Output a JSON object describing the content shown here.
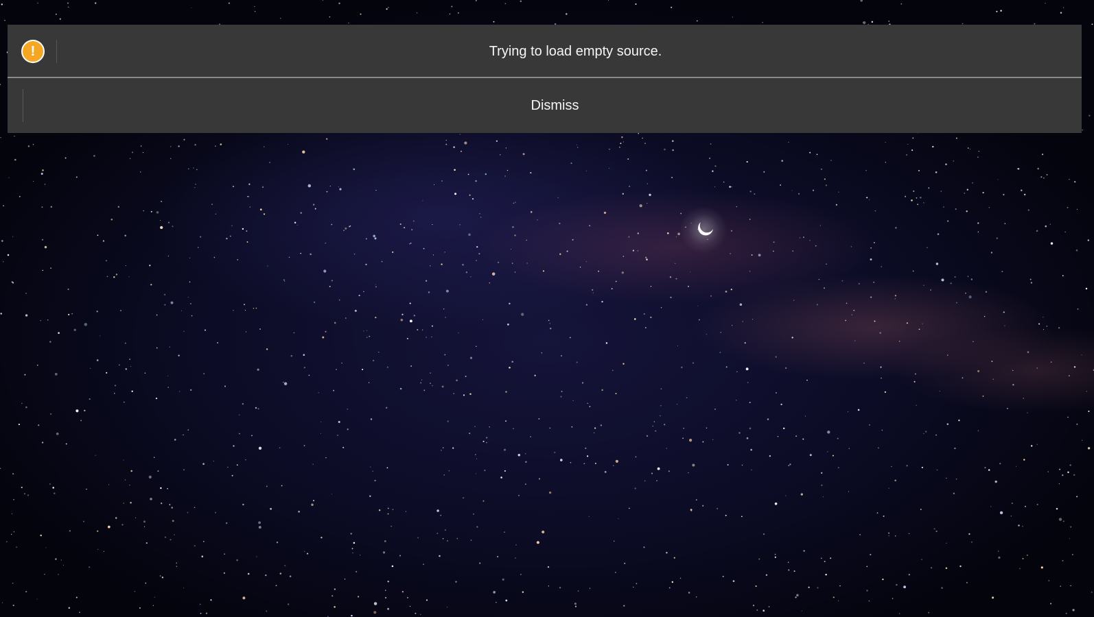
{
  "notification": {
    "icon": "warning-icon",
    "icon_glyph": "!",
    "icon_color": "#f5a623",
    "message": "Trying to load empty source.",
    "dismiss_label": "Dismiss",
    "background_color": "#383838"
  },
  "background": {
    "description_icon": "night-sky-background",
    "moon_icon": "crescent-moon-icon"
  }
}
